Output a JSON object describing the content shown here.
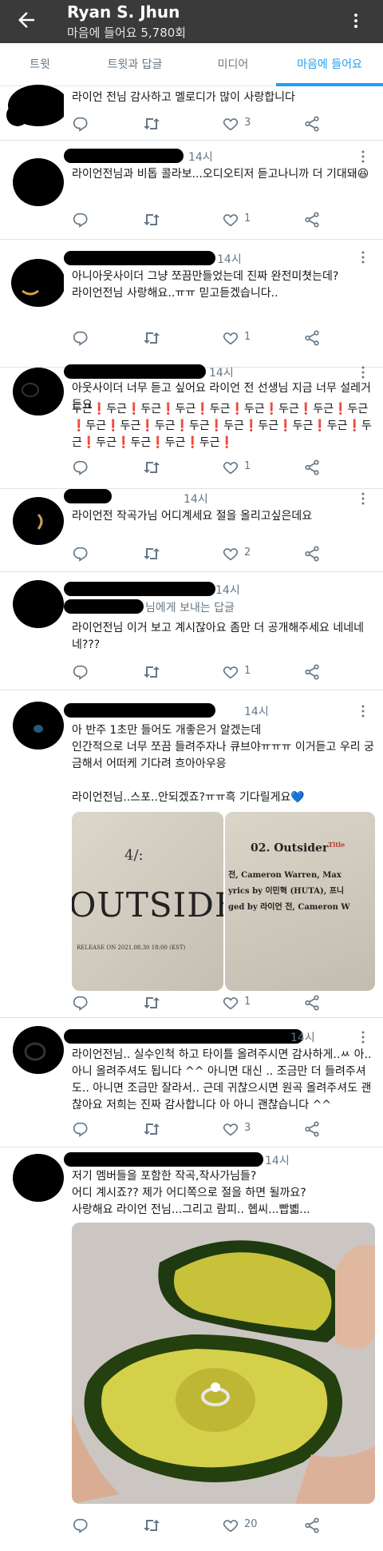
{
  "header": {
    "title": "Ryan S. Jhun",
    "subtitle": "마음에 들어요 5,780회"
  },
  "tabs": [
    {
      "label": "트윗"
    },
    {
      "label": "트윗과 답글"
    },
    {
      "label": "미디어"
    },
    {
      "label": "마음에 들어요",
      "active": true
    }
  ],
  "colors": {
    "accent": "#1da1f2",
    "header_bg": "#3a3a3a",
    "muted": "#657786"
  },
  "tweets": [
    {
      "time": "",
      "text": "라이언 전님 감사하고 멜로디가 많이 사랑합니다",
      "like_count": "3"
    },
    {
      "time": "14시",
      "text": "라이언전님과 비톱 콜라보...오디오티저 듣고나니까 더 기대돼😆",
      "like_count": "1"
    },
    {
      "time": "14시",
      "text": "아니아웃사이더 그냥 쪼끔만들었는데 진짜 완전미쳣는데?\n라이언전님 사랑해요..ㅠㅠ 믿고듣겠습니다..",
      "like_count": "1"
    },
    {
      "time": "14시",
      "text": "아웃사이더 너무 듣고 싶어요 라이언 전 선생님 지금 너무 설레거든요",
      "text2": "두근❗두근❗두근❗두근❗두근❗두근❗두근❗두근❗두근❗두근❗두근❗두근❗두근❗두근❗두근❗두근❗두근❗두근❗두근❗두근❗두근❗두근❗",
      "like_count": "1"
    },
    {
      "time": "14시",
      "text": "라이언전 작곡가님 어디계세요 절을 올리고싶은데요",
      "like_count": "2"
    },
    {
      "time": "14시",
      "replyto": "님에게 보내는 답글",
      "text": "라이언전님 이거 보고 계시잖아요 좀만 더 공개해주세요 네네네네???",
      "like_count": "1"
    },
    {
      "time": "14시",
      "text": "아 반주 1초만 들어도 개좋은거 알겠는데\n인간적으로 너무 쪼끔 들려주자나 큐브야ㅠㅠㅠ 이거듣고 우리 궁금해서 어떠케 기다려 흐아아우응\n\n라이언전님..스포..안되겠죠?ㅠㅠ흑 기다릴게요💙",
      "like_count": "1",
      "media_left": {
        "big_text": "OUTSIDE",
        "small_text": "RELEASE ON 2021.08.30 18:00 (KST)",
        "logo": "4/:"
      },
      "media_right": {
        "track_title": "02. Outsider",
        "title_tag": "Title",
        "line1": "전, Cameron Warren, Max",
        "line2": "yrics by 이민혁 (HUTA), 프니",
        "line3": "ged by 라이언 전, Cameron W"
      }
    },
    {
      "time": "14시",
      "text": "라이언전님.. 실수인척 하고 타이틀 올려주시면 감사하게..ㅆ 아..아니 올려주셔도 됩니다 ^^ 아니면 대신 .. 조금만 더 들려주셔도.. 아니면 조금만 잘라서.. 근데 귀찮으시면 원곡 올려주셔도 괜찮아요 저희는 진짜 감사합니다 아 아니 괜찮습니다 ^^",
      "like_count": "3"
    },
    {
      "time": "14시",
      "text": "저기 멤버들을 포함한 작곡,작사가님들?\n어디 계시죠?? 제가 어디쪽으로 절을 하면 될까요?\n사랑해요 라이언 전님...그리고 람피.. 혭씨...빱볣...",
      "like_count": "20"
    }
  ]
}
